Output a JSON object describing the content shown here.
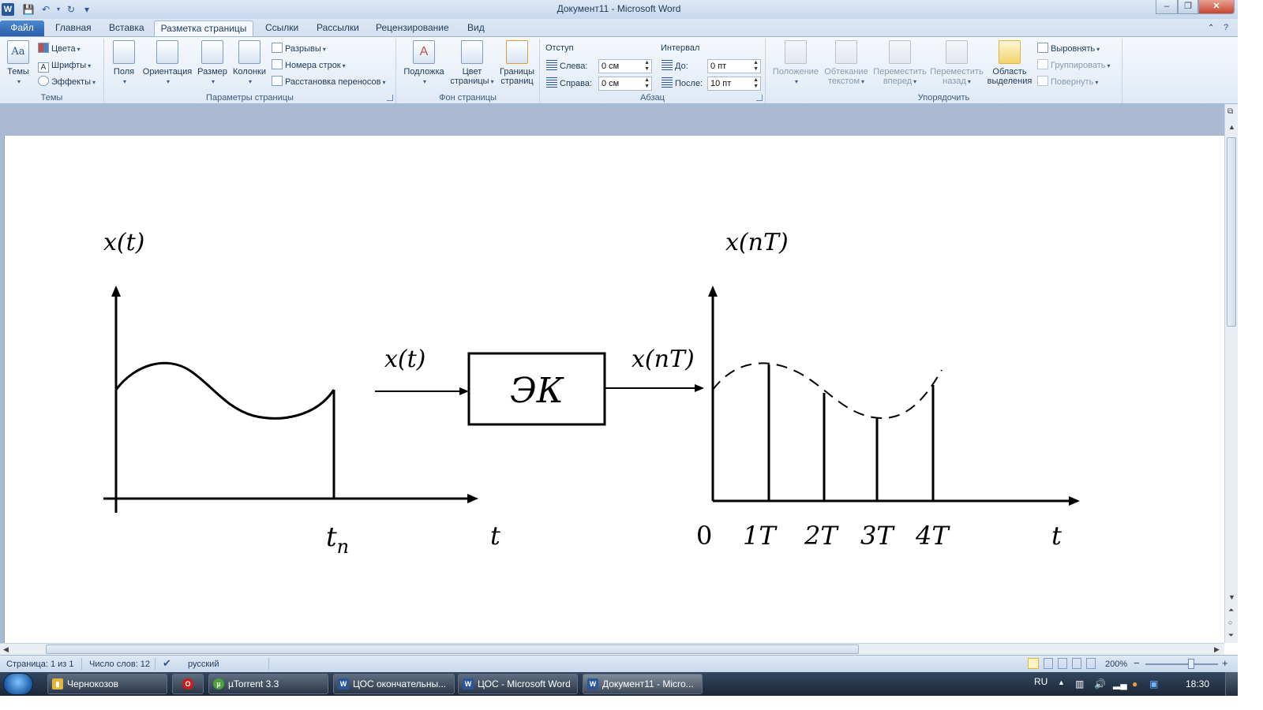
{
  "window": {
    "title": "Документ11  -  Microsoft Word",
    "logo": "W",
    "minimize_glyph": "–",
    "restore_glyph": "❐",
    "close_glyph": "✕"
  },
  "quick_access": [
    {
      "icon": "save-icon",
      "glyph": "💾"
    },
    {
      "icon": "undo-icon",
      "glyph": "↶"
    },
    {
      "icon": "redo-icon",
      "glyph": "↻"
    },
    {
      "icon": "customize-qat-icon",
      "glyph": "▾"
    }
  ],
  "tabs": [
    "Файл",
    "Главная",
    "Вставка",
    "Разметка страницы",
    "Ссылки",
    "Рассылки",
    "Рецензирование",
    "Вид"
  ],
  "active_tab": "Разметка страницы",
  "ribbon": {
    "themes": {
      "label": "Темы",
      "themes_btn": "Темы",
      "colors": "Цвета",
      "fonts": "Шрифты",
      "effects": "Эффекты"
    },
    "page_setup": {
      "label": "Параметры страницы",
      "margins": "Поля",
      "orientation": "Ориентация",
      "size": "Размер",
      "columns": "Колонки",
      "breaks": "Разрывы",
      "line_numbers": "Номера строк",
      "hyphenation": "Расстановка переносов"
    },
    "page_background": {
      "label": "Фон страницы",
      "watermark": "Подложка",
      "page_color_1": "Цвет",
      "page_color_2": "страницы",
      "page_borders_1": "Границы",
      "page_borders_2": "страниц"
    },
    "paragraph": {
      "label": "Абзац",
      "indent_header": "Отступ",
      "indent_left_label": "Слева:",
      "indent_left_value": "0 см",
      "indent_right_label": "Справа:",
      "indent_right_value": "0 см",
      "spacing_header": "Интервал",
      "spacing_before_label": "До:",
      "spacing_before_value": "0 пт",
      "spacing_after_label": "После:",
      "spacing_after_value": "10 пт"
    },
    "arrange": {
      "label": "Упорядочить",
      "position": "Положение",
      "wrap_1": "Обтекание",
      "wrap_2": "текстом",
      "forward_1": "Переместить",
      "forward_2": "вперед",
      "backward_1": "Переместить",
      "backward_2": "назад",
      "selection_1": "Область",
      "selection_2": "выделения",
      "align": "Выровнять",
      "group": "Группировать",
      "rotate": "Повернуть"
    }
  },
  "figure": {
    "left_plot_ylabel": "x(t)",
    "left_plot_xtick": "t",
    "left_plot_xtick_sub": "n",
    "left_plot_xlabel": "t",
    "input_label": "x(t)",
    "block_label": "ЭК",
    "output_label": "x(nT)",
    "right_plot_ylabel": "x(nT)",
    "right_plot_ticks": [
      "0",
      "1T",
      "2T",
      "3T",
      "4T"
    ],
    "right_plot_xlabel": "t"
  },
  "status_bar": {
    "page": "Страница: 1 из 1",
    "words": "Число слов: 12",
    "language": "русский",
    "zoom": "200%",
    "zoom_minus": "−",
    "zoom_plus": "+"
  },
  "taskbar": {
    "items": [
      {
        "label": "Чернокозов",
        "icon": "folder-icon",
        "glyph": "▮",
        "color": "#e3b53a"
      },
      {
        "label": "",
        "icon": "opera-icon",
        "glyph": "O",
        "color": "#cc1b1b"
      },
      {
        "label": "µTorrent 3.3",
        "icon": "utorrent-icon",
        "glyph": "µ",
        "color": "#4aa33d"
      },
      {
        "label": "ЦОС окончательны...",
        "icon": "word-icon",
        "glyph": "W",
        "color": "#2b579a"
      },
      {
        "label": "ЦОС - Microsoft Word",
        "icon": "word-icon",
        "glyph": "W",
        "color": "#2b579a"
      },
      {
        "label": "Документ11 - Micro...",
        "icon": "word-icon",
        "glyph": "W",
        "color": "#2b579a"
      }
    ],
    "lang": "RU",
    "clock": "18:30"
  },
  "colors": {
    "accent": "#2b579a",
    "ribbon_bg": "#dfe9f5",
    "doc_bg": "#abbad3"
  }
}
